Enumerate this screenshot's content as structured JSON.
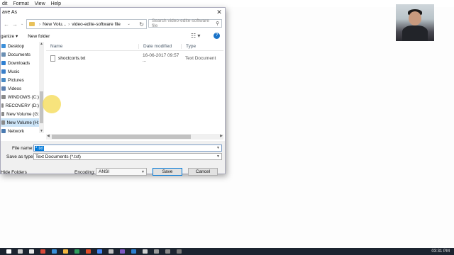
{
  "notepad": {
    "menu": [
      "dit",
      "Format",
      "View",
      "Help"
    ]
  },
  "dialog": {
    "title": "ave As",
    "breadcrumb": [
      "New Volu...",
      "video-edite-software file"
    ],
    "search_placeholder": "Search video-edite-software file",
    "toolbar": {
      "organize": "ganize ▾",
      "new_folder": "New folder"
    },
    "sidebar": [
      {
        "label": "Desktop",
        "color": "#3b8fd9"
      },
      {
        "label": "Documents",
        "color": "#6a8fb3"
      },
      {
        "label": "Downloads",
        "color": "#2f7fd1"
      },
      {
        "label": "Music",
        "color": "#3a7ec8"
      },
      {
        "label": "Pictures",
        "color": "#4a8ac4"
      },
      {
        "label": "Videos",
        "color": "#5b7fb0"
      },
      {
        "label": "WINDOWS (C:)",
        "color": "#8a8a8a"
      },
      {
        "label": "RECOVERY (D:)",
        "color": "#8a8a8a"
      },
      {
        "label": "New Volume (G:",
        "color": "#8a8a8a"
      },
      {
        "label": "New Volume (H:",
        "color": "#8a8a8a",
        "selected": true
      },
      {
        "label": "Network",
        "color": "#4a7ab0"
      }
    ],
    "columns": {
      "name": "Name",
      "date": "Date modified",
      "type": "Type"
    },
    "files": [
      {
        "name": "shoctcorts.txt",
        "date": "16-06-2017 09:57 ...",
        "type": "Text Document"
      }
    ],
    "file_name_label": "File name:",
    "file_name_value": "*.txt",
    "save_type_label": "Save as type:",
    "save_type_value": "Text Documents (*.txt)",
    "hide_folders": "Hide Folders",
    "encoding_label": "Encoding:",
    "encoding_value": "ANSI",
    "save_button": "Save",
    "cancel_button": "Cancel"
  },
  "taskbar": {
    "clock": "03:31 PM",
    "icon_colors": [
      "#ffffff",
      "#cccccc",
      "#e8e8e8",
      "#d84a3a",
      "#3a8fd8",
      "#f2b640",
      "#2f9e5c",
      "#e34c26",
      "#4285f4",
      "#c0c0c0",
      "#7e57c2",
      "#2c7fd0",
      "#d0d0d0",
      "#999999",
      "#888888",
      "#777777"
    ]
  }
}
